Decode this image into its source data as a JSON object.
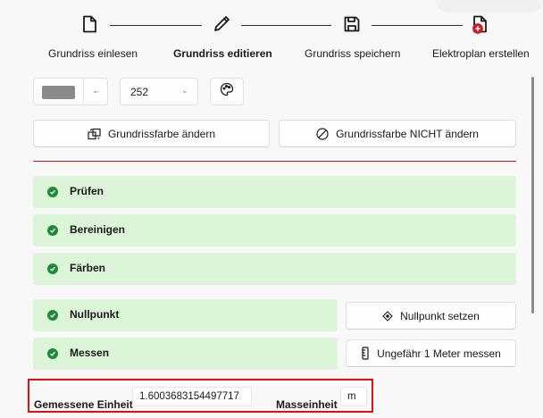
{
  "stepper": {
    "steps": [
      {
        "label": "Grundriss einlesen",
        "icon": "file-icon",
        "active": false
      },
      {
        "label": "Grundriss editieren",
        "icon": "pencil-icon",
        "active": true
      },
      {
        "label": "Grundriss speichern",
        "icon": "save-icon",
        "active": false
      },
      {
        "label": "Elektroplan erstellen",
        "icon": "file-add-icon",
        "active": false
      }
    ]
  },
  "toolbar": {
    "color_swatch": "#8a8a8a",
    "line_width": "252",
    "palette_icon": "palette-icon"
  },
  "color_buttons": {
    "change": "Grundrissfarbe ändern",
    "keep": "Grundrissfarbe NICHT ändern"
  },
  "checks": [
    {
      "label": "Prüfen",
      "status": "done"
    },
    {
      "label": "Bereinigen",
      "status": "done"
    },
    {
      "label": "Färben",
      "status": "done"
    },
    {
      "label": "Nullpunkt",
      "status": "done"
    },
    {
      "label": "Messen",
      "status": "done"
    }
  ],
  "actions": {
    "set_origin": "Nullpunkt setzen",
    "measure": "Ungefähr 1 Meter messen"
  },
  "measurement": {
    "measured_label": "Gemessene Einheit",
    "measured_value": "1.6003683154497717",
    "unit_label": "Masseinheit",
    "unit_value": "m"
  },
  "colors": {
    "accent_red": "#b81a1a",
    "success_bg": "#dcf5d8",
    "success_dot": "#1f8a3a",
    "highlight_border": "#e01010"
  }
}
